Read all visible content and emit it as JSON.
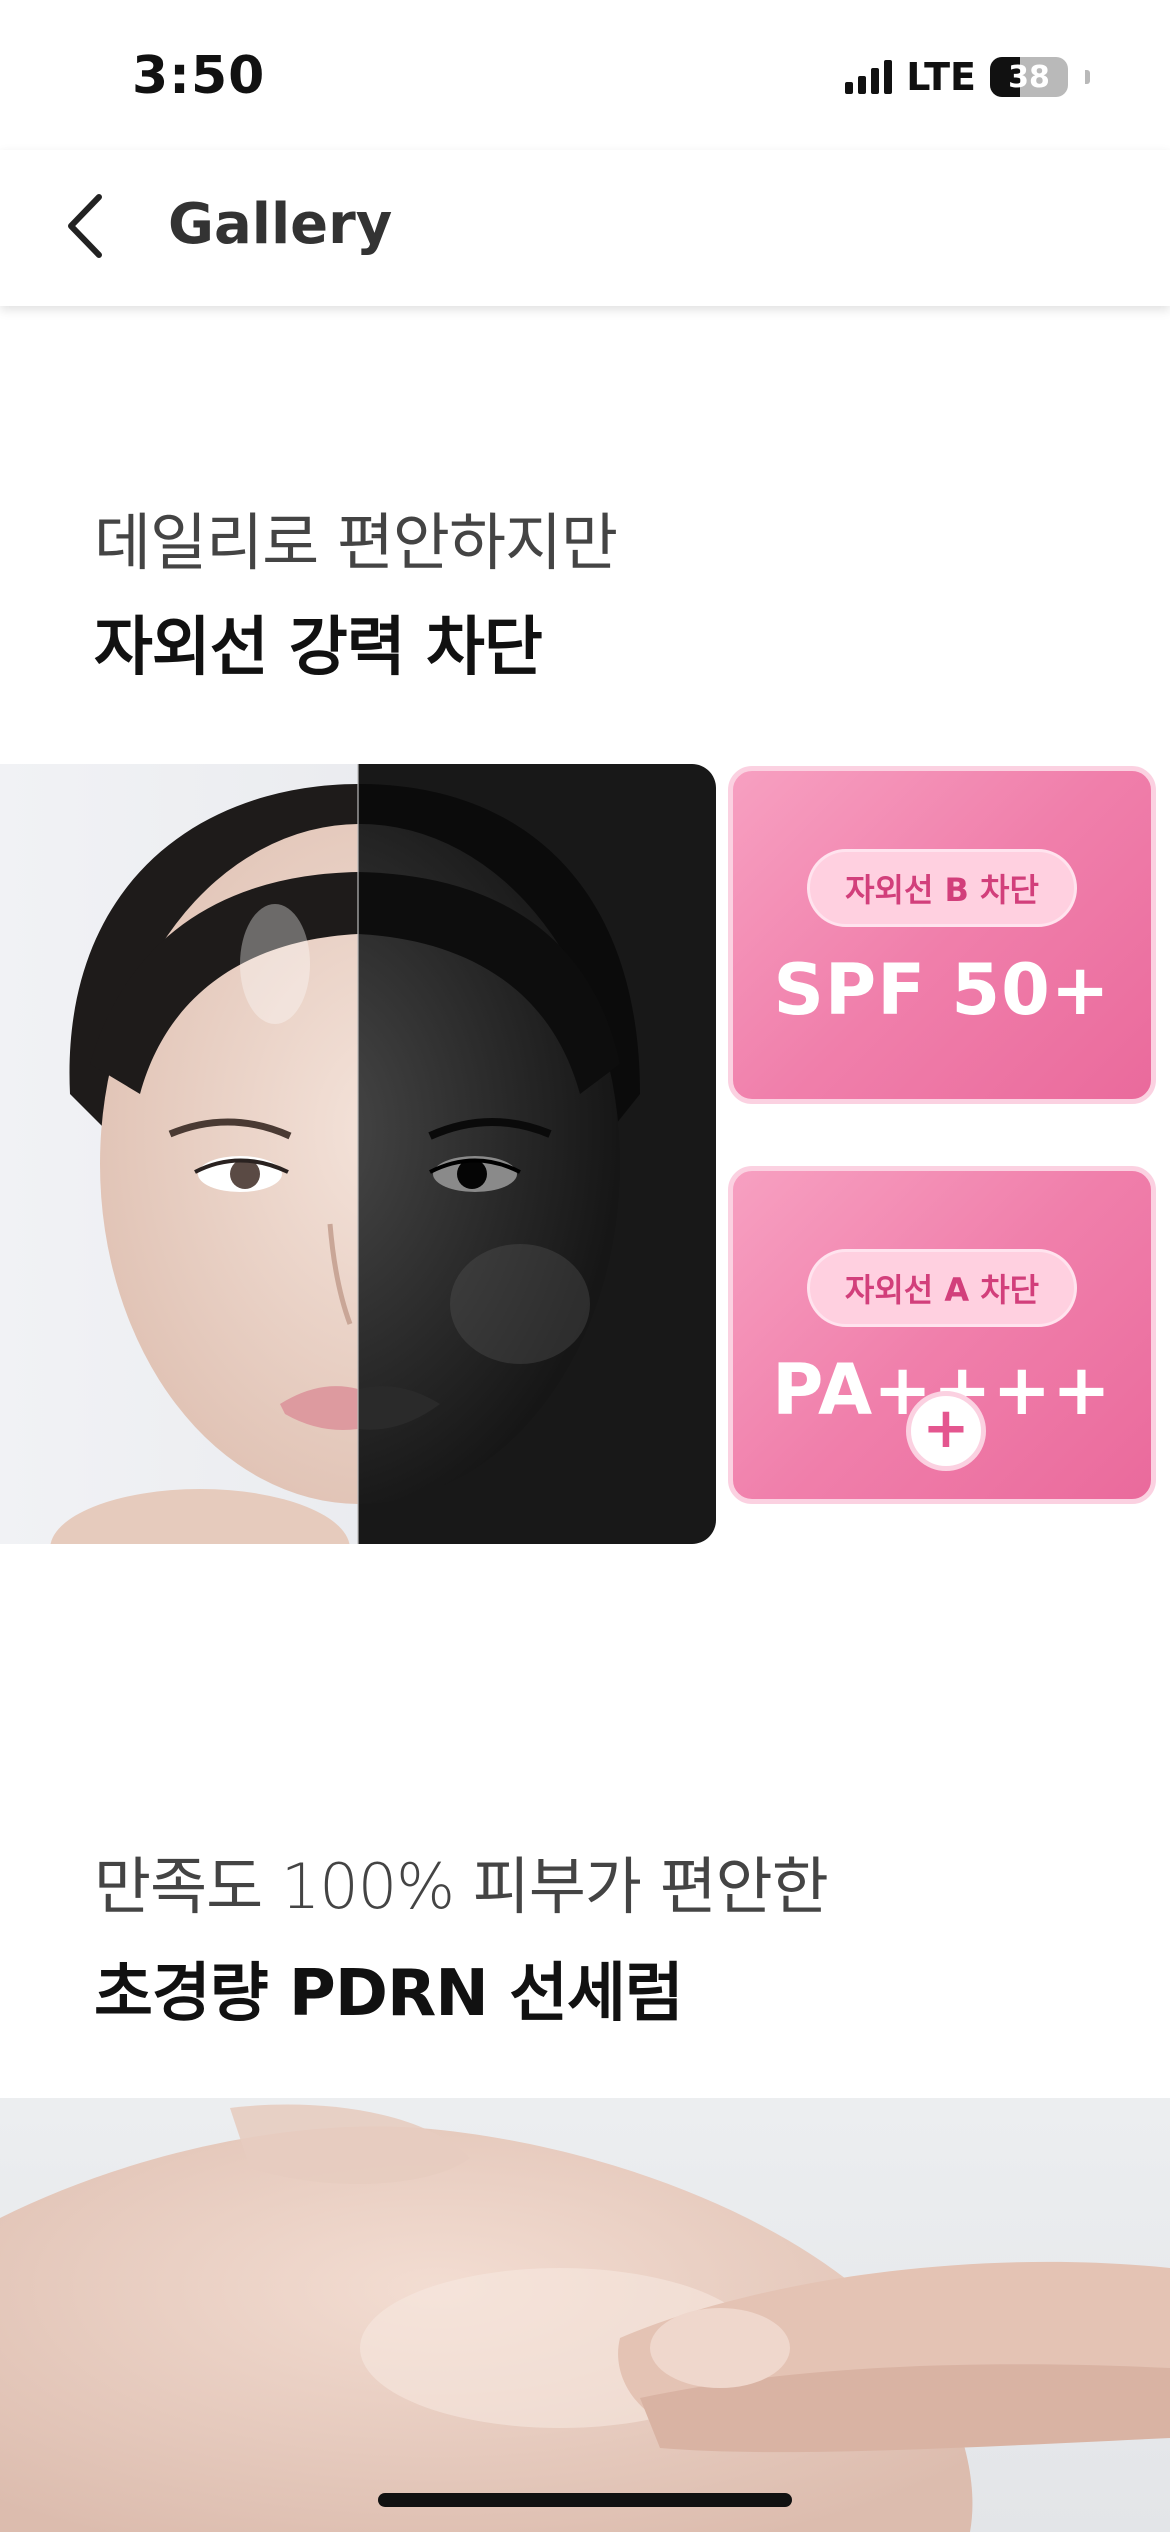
{
  "status_bar": {
    "time": "3:50",
    "network": "LTE",
    "battery": "38",
    "battery_level": 0.38
  },
  "nav": {
    "title": "Gallery",
    "back_icon": "chevron-left-icon"
  },
  "section_1": {
    "line1": "데일리로 편안하지만",
    "line2": "자외선 강력 차단"
  },
  "uv_card_b": {
    "badge": "자외선 B 차단",
    "value": "SPF 50+"
  },
  "uv_card_a": {
    "badge": "자외선 A 차단",
    "value": "PA++++"
  },
  "plus_sign": "+",
  "section_2": {
    "line1": "만족도 100% 피부가 편안한",
    "line2": "초경량 PDRN 선세럼"
  },
  "colors": {
    "card_pink": "#f07fab",
    "badge_text": "#d23f7b"
  }
}
